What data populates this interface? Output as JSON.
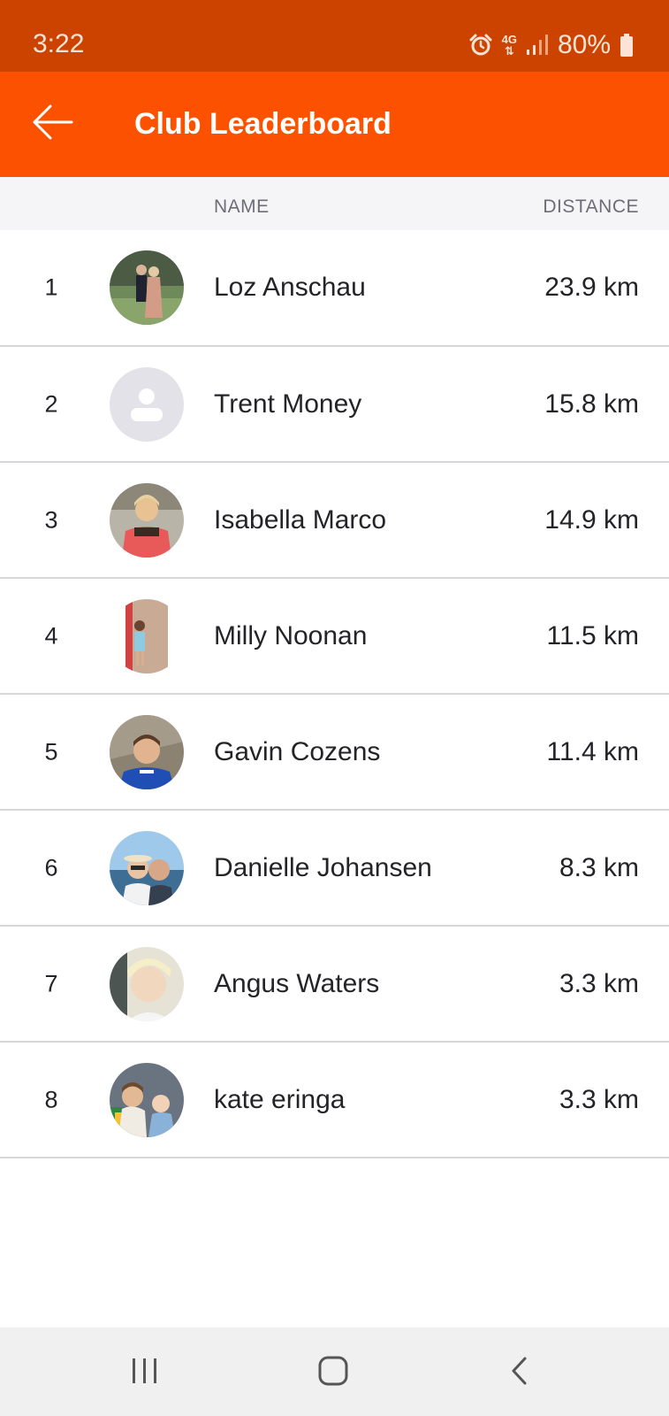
{
  "status_bar": {
    "time": "3:22",
    "network": "4G",
    "battery": "80%",
    "icons": [
      "alarm-icon",
      "network-icon",
      "signal-icon",
      "battery-icon"
    ]
  },
  "app_bar": {
    "title": "Club Leaderboard",
    "back_icon": "arrow-left-icon"
  },
  "columns": {
    "name": "NAME",
    "distance": "DISTANCE"
  },
  "colors": {
    "status_bar": "#cc4300",
    "app_bar": "#fc5200",
    "header_bg": "#f5f5f7",
    "text": "#242428",
    "muted_text": "#6d6d78",
    "divider": "#d7d7db",
    "nav_bar": "#f0f0f0"
  },
  "leaderboard": [
    {
      "rank": "1",
      "name": "Loz Anschau",
      "distance": "23.9 km",
      "avatar": "photo"
    },
    {
      "rank": "2",
      "name": "Trent Money",
      "distance": "15.8 km",
      "avatar": "default-person-icon"
    },
    {
      "rank": "3",
      "name": "Isabella Marco",
      "distance": "14.9 km",
      "avatar": "photo"
    },
    {
      "rank": "4",
      "name": "Milly Noonan",
      "distance": "11.5 km",
      "avatar": "photo"
    },
    {
      "rank": "5",
      "name": "Gavin Cozens",
      "distance": "11.4 km",
      "avatar": "photo"
    },
    {
      "rank": "6",
      "name": "Danielle Johansen",
      "distance": "8.3 km",
      "avatar": "photo"
    },
    {
      "rank": "7",
      "name": "Angus Waters",
      "distance": "3.3 km",
      "avatar": "photo"
    },
    {
      "rank": "8",
      "name": "kate eringa",
      "distance": "3.3 km",
      "avatar": "photo"
    }
  ],
  "nav_bar": {
    "icons": [
      "recents-icon",
      "home-icon",
      "back-chevron-icon"
    ]
  }
}
